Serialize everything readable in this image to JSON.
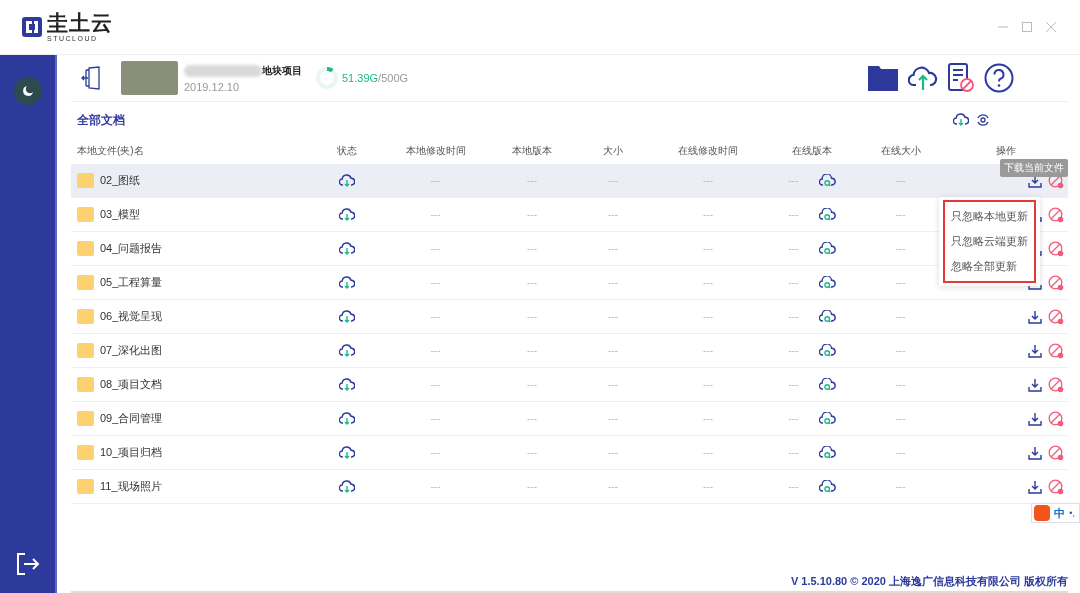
{
  "app": {
    "logo_text": "圭土云",
    "logo_subtext": "STUCLOUD"
  },
  "project": {
    "name": "地块项目",
    "date": "2019.12.10",
    "storage_used": "51.39G",
    "storage_total": "/500G",
    "level": 0.1
  },
  "section_title": "全部文档",
  "table": {
    "columns": [
      "本地文件(夹)名",
      "状态",
      "本地修改时间",
      "本地版本",
      "大小",
      "在线修改时间",
      "在线版本",
      "在线大小",
      "操作"
    ],
    "rows": [
      {
        "name": "02_图纸",
        "local_time": "---",
        "local_version": "---",
        "size": "---",
        "online_time": "---",
        "online_version": "---",
        "online_size": "---",
        "hovered": true
      },
      {
        "name": "03_模型",
        "local_time": "---",
        "local_version": "---",
        "size": "---",
        "online_time": "---",
        "online_version": "---",
        "online_size": "---",
        "hovered": false
      },
      {
        "name": "04_问题报告",
        "local_time": "---",
        "local_version": "---",
        "size": "---",
        "online_time": "---",
        "online_version": "---",
        "online_size": "---",
        "hovered": false
      },
      {
        "name": "05_工程算量",
        "local_time": "---",
        "local_version": "---",
        "size": "---",
        "online_time": "---",
        "online_version": "---",
        "online_size": "---",
        "hovered": false
      },
      {
        "name": "06_视觉呈现",
        "local_time": "---",
        "local_version": "---",
        "size": "---",
        "online_time": "---",
        "online_version": "---",
        "online_size": "---",
        "hovered": false
      },
      {
        "name": "07_深化出图",
        "local_time": "---",
        "local_version": "---",
        "size": "---",
        "online_time": "---",
        "online_version": "---",
        "online_size": "---",
        "hovered": false
      },
      {
        "name": "08_项目文档",
        "local_time": "---",
        "local_version": "---",
        "size": "---",
        "online_time": "---",
        "online_version": "---",
        "online_size": "---",
        "hovered": false
      },
      {
        "name": "09_合同管理",
        "local_time": "---",
        "local_version": "---",
        "size": "---",
        "online_time": "---",
        "online_version": "---",
        "online_size": "---",
        "hovered": false
      },
      {
        "name": "10_项目归档",
        "local_time": "---",
        "local_version": "---",
        "size": "---",
        "online_time": "---",
        "online_version": "---",
        "online_size": "---",
        "hovered": false
      },
      {
        "name": "11_现场照片",
        "local_time": "---",
        "local_version": "---",
        "size": "---",
        "online_time": "---",
        "online_version": "---",
        "online_size": "---",
        "hovered": false
      }
    ]
  },
  "tooltip": "下载当前文件",
  "ignore_menu": [
    "只忽略本地更新",
    "只忽略云端更新",
    "忽略全部更新"
  ],
  "ime": {
    "mode": "中",
    "punct": "•,"
  },
  "footer": "V 1.5.10.80 © 2020 上海逸广信息科技有限公司 版权所有"
}
